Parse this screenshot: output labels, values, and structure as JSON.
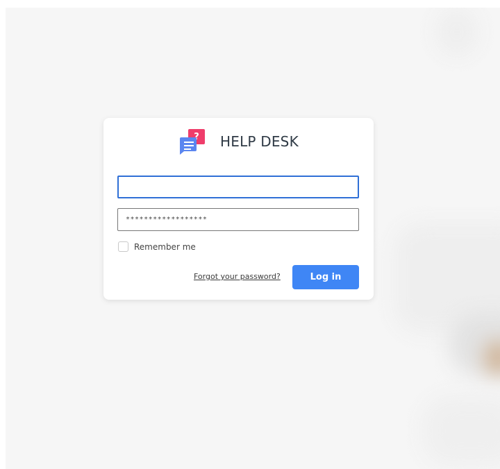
{
  "brand": {
    "title": "HELP DESK",
    "logo_icon": "chat-bubbles-question-icon",
    "colors": {
      "pink": "#ef3d6b",
      "blue": "#5b86f0"
    }
  },
  "login": {
    "username_value": "",
    "password_value": "******************",
    "remember_label": "Remember me",
    "remember_checked": false,
    "forgot_label": "Forgot your password?",
    "login_label": "Log in"
  },
  "colors": {
    "accent": "#3f86f5",
    "focus_border": "#2f6fd6",
    "background": "#f6f6f6"
  }
}
